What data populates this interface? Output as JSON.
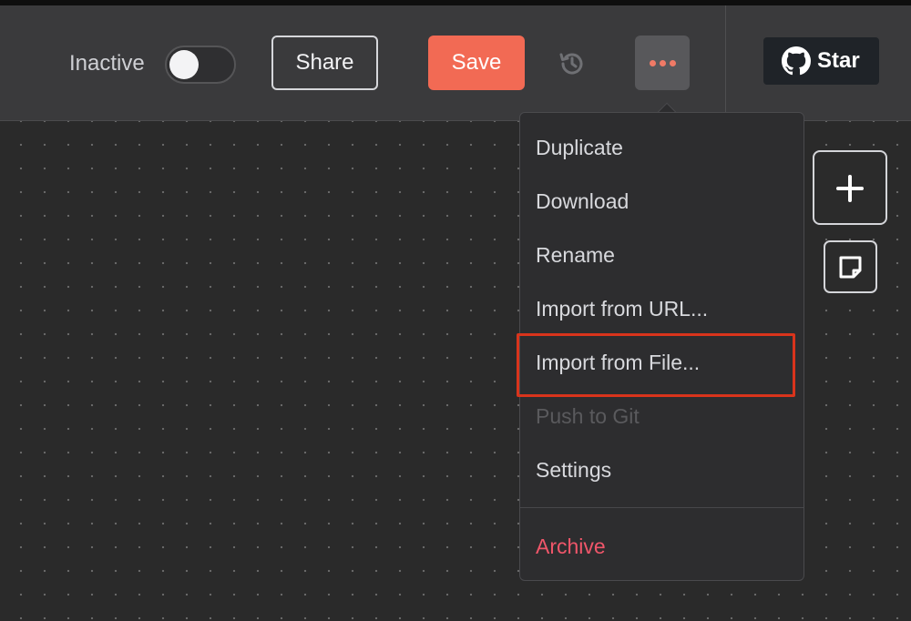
{
  "header": {
    "active_toggle": {
      "label": "Inactive",
      "on": false
    },
    "share_label": "Share",
    "save_label": "Save",
    "save_color": "#f26a54",
    "history_icon": "history-icon",
    "more_icon": "more-horizontal-icon",
    "github": {
      "icon": "github-icon",
      "label": "Star"
    }
  },
  "menu": {
    "items": [
      {
        "label": "Duplicate",
        "disabled": false
      },
      {
        "label": "Download",
        "disabled": false
      },
      {
        "label": "Rename",
        "disabled": false
      },
      {
        "label": "Import from URL...",
        "disabled": false
      },
      {
        "label": "Import from File...",
        "disabled": false,
        "highlighted": true
      },
      {
        "label": "Push to Git",
        "disabled": true
      },
      {
        "label": "Settings",
        "disabled": false
      }
    ],
    "archive_label": "Archive",
    "archive_color": "#f0566a",
    "highlight_color": "#d9341c"
  },
  "canvas_tools": {
    "add_icon": "plus-icon",
    "sticky_icon": "sticky-note-icon"
  }
}
